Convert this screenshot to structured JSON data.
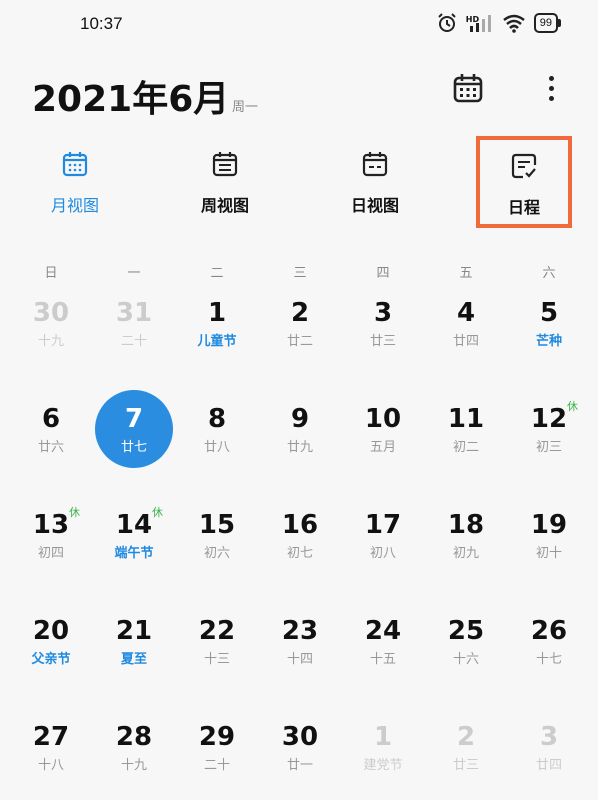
{
  "status_bar": {
    "time": "10:37",
    "battery": "99",
    "hd": "HD"
  },
  "header": {
    "title": "2021年6月",
    "weekday": "周一"
  },
  "tabs": [
    {
      "label": "月视图",
      "active": true
    },
    {
      "label": "周视图",
      "active": false
    },
    {
      "label": "日视图",
      "active": false
    },
    {
      "label": "日程",
      "active": false
    }
  ],
  "weekdays": [
    "日",
    "一",
    "二",
    "三",
    "四",
    "五",
    "六"
  ],
  "rest_label": "休",
  "days": [
    {
      "num": "30",
      "sub": "十九",
      "other": true
    },
    {
      "num": "31",
      "sub": "二十",
      "other": true
    },
    {
      "num": "1",
      "sub": "儿童节",
      "fest": true
    },
    {
      "num": "2",
      "sub": "廿二"
    },
    {
      "num": "3",
      "sub": "廿三"
    },
    {
      "num": "4",
      "sub": "廿四"
    },
    {
      "num": "5",
      "sub": "芒种",
      "fest": true
    },
    {
      "num": "6",
      "sub": "廿六"
    },
    {
      "num": "7",
      "sub": "廿七",
      "today": true
    },
    {
      "num": "8",
      "sub": "廿八"
    },
    {
      "num": "9",
      "sub": "廿九"
    },
    {
      "num": "10",
      "sub": "五月"
    },
    {
      "num": "11",
      "sub": "初二"
    },
    {
      "num": "12",
      "sub": "初三",
      "rest": true
    },
    {
      "num": "13",
      "sub": "初四",
      "rest": true
    },
    {
      "num": "14",
      "sub": "端午节",
      "fest": true,
      "rest": true
    },
    {
      "num": "15",
      "sub": "初六"
    },
    {
      "num": "16",
      "sub": "初七"
    },
    {
      "num": "17",
      "sub": "初八"
    },
    {
      "num": "18",
      "sub": "初九"
    },
    {
      "num": "19",
      "sub": "初十"
    },
    {
      "num": "20",
      "sub": "父亲节",
      "fest": true
    },
    {
      "num": "21",
      "sub": "夏至",
      "fest": true
    },
    {
      "num": "22",
      "sub": "十三"
    },
    {
      "num": "23",
      "sub": "十四"
    },
    {
      "num": "24",
      "sub": "十五"
    },
    {
      "num": "25",
      "sub": "十六"
    },
    {
      "num": "26",
      "sub": "十七"
    },
    {
      "num": "27",
      "sub": "十八"
    },
    {
      "num": "28",
      "sub": "十九"
    },
    {
      "num": "29",
      "sub": "二十"
    },
    {
      "num": "30",
      "sub": "廿一"
    },
    {
      "num": "1",
      "sub": "建党节",
      "other": true
    },
    {
      "num": "2",
      "sub": "廿三",
      "other": true
    },
    {
      "num": "3",
      "sub": "廿四",
      "other": true
    }
  ],
  "colors": {
    "accent": "#1f8ae0",
    "today_bg": "#2a8de0",
    "rest": "#3bb34a",
    "highlight_border": "#f06a3c"
  },
  "icons": {
    "calendar_button": "calendar-grid-icon",
    "more_button": "more-vertical-icon"
  }
}
